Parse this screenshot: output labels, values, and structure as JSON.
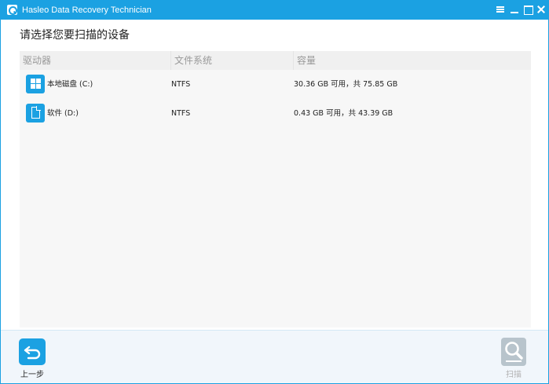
{
  "window": {
    "title": "Hasleo Data Recovery Technician",
    "accent_color": "#1ba1e2"
  },
  "page": {
    "heading": "请选择您要扫描的设备"
  },
  "table": {
    "columns": [
      "驱动器",
      "文件系统",
      "容量"
    ],
    "rows": [
      {
        "icon": "windows-drive-icon",
        "name": "本地磁盘 (C:)",
        "filesystem": "NTFS",
        "capacity": "30.36 GB 可用，共 75.85 GB"
      },
      {
        "icon": "document-drive-icon",
        "name": "软件 (D:)",
        "filesystem": "NTFS",
        "capacity": "0.43 GB 可用，共 43.39 GB"
      }
    ]
  },
  "footer": {
    "back_label": "上一步",
    "scan_label": "扫描"
  }
}
